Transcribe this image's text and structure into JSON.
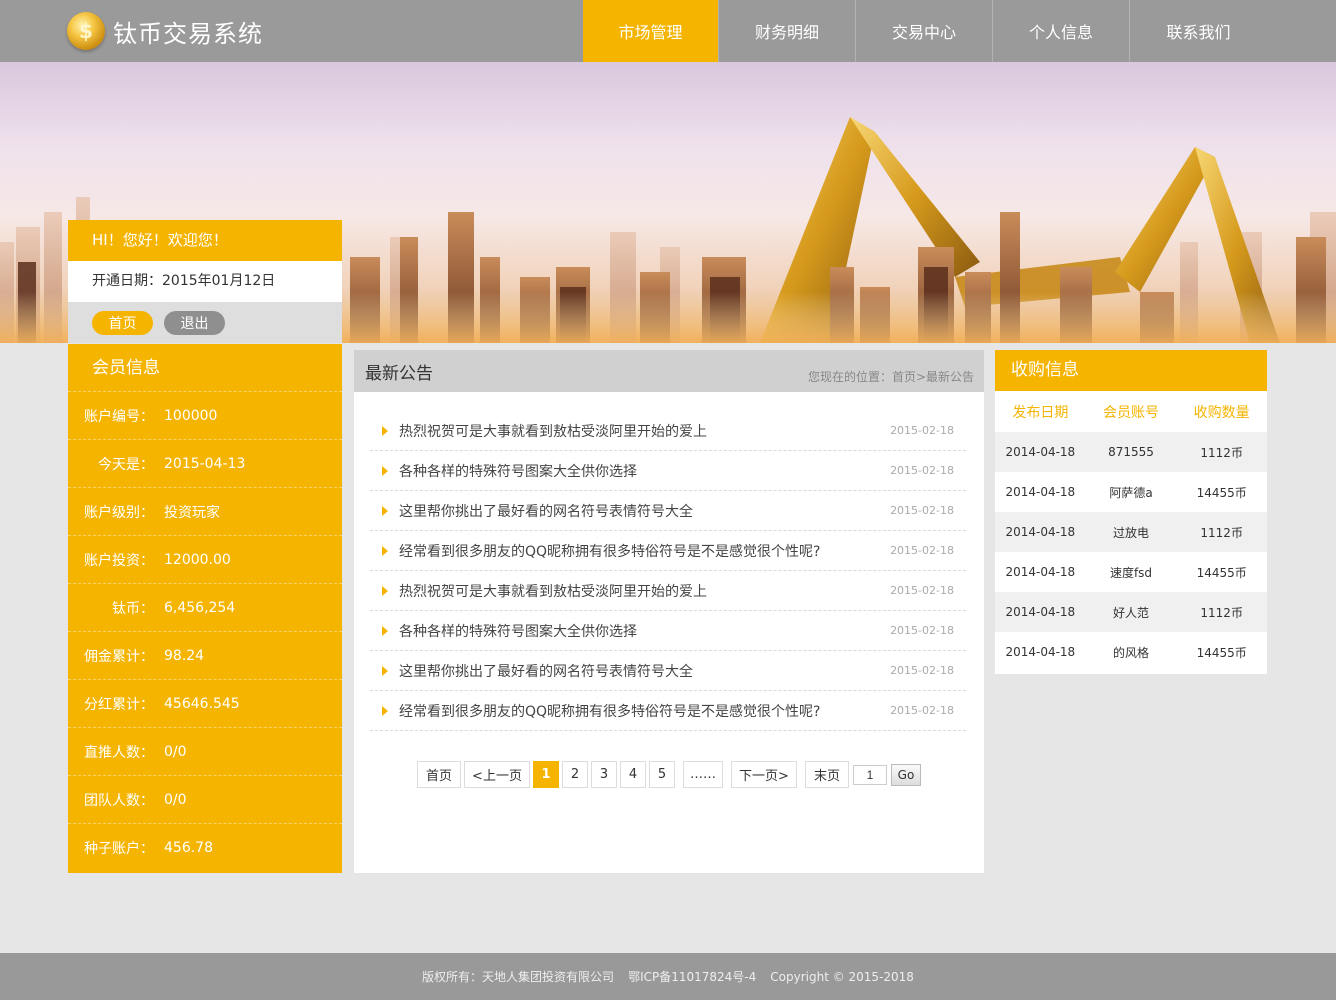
{
  "header": {
    "logo_symbol": "$",
    "logo_text": "钛币交易系统",
    "nav": [
      {
        "label": "市场管理",
        "active": true
      },
      {
        "label": "财务明细",
        "active": false
      },
      {
        "label": "交易中心",
        "active": false
      },
      {
        "label": "个人信息",
        "active": false
      },
      {
        "label": "联系我们",
        "active": false
      }
    ]
  },
  "welcome": {
    "greeting": "HI！您好！欢迎您！",
    "open_date": "开通日期：2015年01月12日",
    "home_button": "首页",
    "logout_button": "退出"
  },
  "member": {
    "title": "会员信息",
    "rows": [
      {
        "label": "账户编号：",
        "value": "100000"
      },
      {
        "label": "今天是：",
        "value": "2015-04-13"
      },
      {
        "label": "账户级别：",
        "value": "投资玩家"
      },
      {
        "label": "账户投资：",
        "value": "12000.00"
      },
      {
        "label": "钛币：",
        "value": "6,456,254"
      },
      {
        "label": "佣金累计：",
        "value": "98.24"
      },
      {
        "label": "分红累计：",
        "value": "45646.545"
      },
      {
        "label": "直推人数：",
        "value": "0/0"
      },
      {
        "label": "团队人数：",
        "value": "0/0"
      },
      {
        "label": "种子账户：",
        "value": "456.78"
      }
    ]
  },
  "notice": {
    "title": "最新公告",
    "breadcrumb": "您现在的位置：首页>最新公告",
    "items": [
      {
        "text": "热烈祝贺可是大事就看到敖枯受淡阿里开始的爱上",
        "date": "2015-02-18"
      },
      {
        "text": "各种各样的特殊符号图案大全供你选择",
        "date": "2015-02-18"
      },
      {
        "text": "这里帮你挑出了最好看的网名符号表情符号大全",
        "date": "2015-02-18"
      },
      {
        "text": "经常看到很多朋友的QQ昵称拥有很多特俗符号是不是感觉很个性呢?",
        "date": "2015-02-18"
      },
      {
        "text": "热烈祝贺可是大事就看到敖枯受淡阿里开始的爱上",
        "date": "2015-02-18"
      },
      {
        "text": "各种各样的特殊符号图案大全供你选择",
        "date": "2015-02-18"
      },
      {
        "text": "这里帮你挑出了最好看的网名符号表情符号大全",
        "date": "2015-02-18"
      },
      {
        "text": "经常看到很多朋友的QQ昵称拥有很多特俗符号是不是感觉很个性呢?",
        "date": "2015-02-18"
      }
    ],
    "pager": {
      "first": "首页",
      "prev": "<上一页",
      "pages": [
        "1",
        "2",
        "3",
        "4",
        "5"
      ],
      "current": "1",
      "ellipsis": "……",
      "next": "下一页>",
      "last": "末页",
      "input_value": "1",
      "go": "Go"
    }
  },
  "purchase": {
    "title": "收购信息",
    "columns": [
      "发布日期",
      "会员账号",
      "收购数量"
    ],
    "rows": [
      [
        "2014-04-18",
        "871555",
        "1112币"
      ],
      [
        "2014-04-18",
        "阿萨德a",
        "14455币"
      ],
      [
        "2014-04-18",
        "过放电",
        "1112币"
      ],
      [
        "2014-04-18",
        "速度fsd",
        "14455币"
      ],
      [
        "2014-04-18",
        "好人范",
        "1112币"
      ],
      [
        "2014-04-18",
        "的风格",
        "14455币"
      ]
    ]
  },
  "footer": {
    "copyright_owner": "版权所有：天地人集团投资有限公司",
    "icp": "鄂ICP备11017824号-4",
    "copyright": "Copyright © 2015-2018"
  },
  "colors": {
    "accent": "#f5b400",
    "header_bg": "#9a9a9a",
    "footer_bg": "#999999",
    "page_bg": "#e7e6e6"
  }
}
